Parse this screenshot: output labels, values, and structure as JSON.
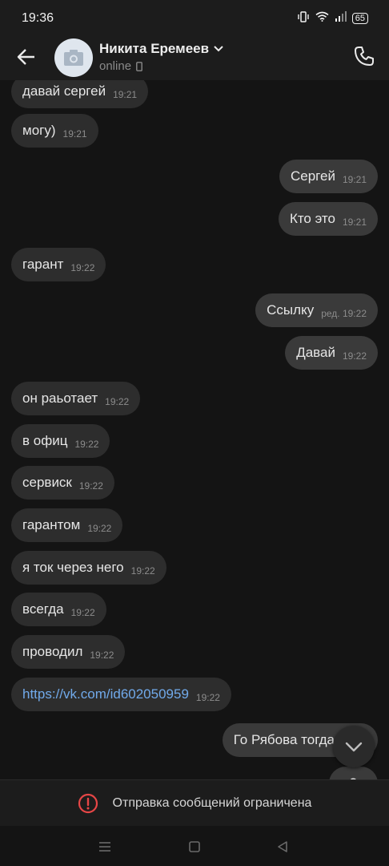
{
  "status_bar": {
    "time": "19:36",
    "battery": "65"
  },
  "header": {
    "name": "Никита Еремеев",
    "status": "online"
  },
  "messages": [
    {
      "dir": "in",
      "text": "давай сергей",
      "time": "19:21"
    },
    {
      "dir": "in",
      "text": "могу)",
      "time": "19:21"
    },
    {
      "dir": "out",
      "text": "Сергей",
      "time": "19:21"
    },
    {
      "dir": "out",
      "text": "Кто это",
      "time": "19:21"
    },
    {
      "dir": "in",
      "text": "гарант",
      "time": "19:22"
    },
    {
      "dir": "out",
      "text": "Ссылку",
      "time": "ред. 19:22"
    },
    {
      "dir": "out",
      "text": "Давай",
      "time": "19:22"
    },
    {
      "dir": "in",
      "text": "он раьотает",
      "time": "19:22"
    },
    {
      "dir": "in",
      "text": "в офиц",
      "time": "19:22"
    },
    {
      "dir": "in",
      "text": "сервиск",
      "time": "19:22"
    },
    {
      "dir": "in",
      "text": "гарантом",
      "time": "19:22"
    },
    {
      "dir": "in",
      "text": "я ток через него",
      "time": "19:22"
    },
    {
      "dir": "in",
      "text": "всегда",
      "time": "19:22"
    },
    {
      "dir": "in",
      "text": "проводил",
      "time": "19:22"
    },
    {
      "dir": "in",
      "text": "https://vk.com/id602050959",
      "time": "19:22"
    },
    {
      "dir": "out",
      "text": "Го Рябова тогда",
      "time": ""
    },
    {
      "dir": "out",
      "text": "?",
      "time": ""
    }
  ],
  "composer": {
    "restricted_text": "Отправка сообщений ограничена"
  },
  "colors": {
    "link": "#71aaeb",
    "warning": "#e64646",
    "incoming_bubble": "#2d2d2d",
    "outgoing_bubble": "#3a3a3a"
  }
}
